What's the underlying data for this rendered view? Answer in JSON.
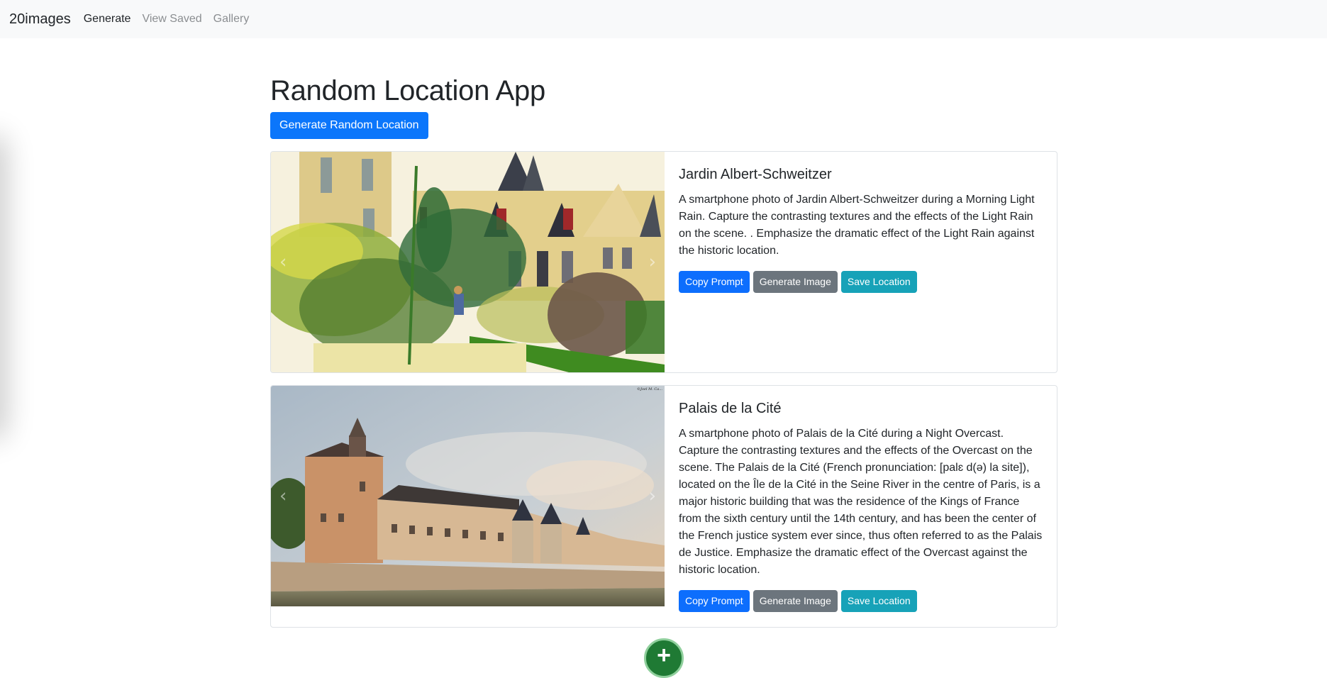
{
  "navbar": {
    "brand": "20images",
    "links": [
      {
        "label": "Generate",
        "active": true
      },
      {
        "label": "View Saved",
        "active": false
      },
      {
        "label": "Gallery",
        "active": false
      }
    ]
  },
  "main": {
    "title": "Random Location App",
    "generate_button": "Generate Random Location",
    "cards": [
      {
        "title": "Jardin Albert-Schweitzer",
        "image_description": "Watercolor sketch of a chateau with gardens and trees",
        "prompt": "A smartphone photo of Jardin Albert-Schweitzer during a Morning Light Rain. Capture the contrasting textures and the effects of the Light Rain on the scene. . Emphasize the dramatic effect of the Light Rain against the historic location.",
        "buttons": {
          "copy": "Copy Prompt",
          "generate": "Generate Image",
          "save": "Save Location"
        }
      },
      {
        "title": "Palais de la Cité",
        "image_description": "Photo of the Conciergerie along the Seine under a cloudy sky",
        "image_watermark": "©Joel M. Ca...",
        "prompt": "A smartphone photo of Palais de la Cité during a Night Overcast. Capture the contrasting textures and the effects of the Overcast on the scene. The Palais de la Cité (French pronunciation: [palɛ d(ə) la site]), located on the Île de la Cité in the Seine River in the centre of Paris, is a major historic building that was the residence of the Kings of France from the sixth century until the 14th century, and has been the center of the French justice system ever since, thus often referred to as the Palais de Justice. Emphasize the dramatic effect of the Overcast against the historic location.",
        "buttons": {
          "copy": "Copy Prompt",
          "generate": "Generate Image",
          "save": "Save Location"
        }
      }
    ],
    "carousel_controls": {
      "prev": "‹",
      "next": "›"
    },
    "fab_label": "+"
  },
  "colors": {
    "primary": "#0d6efd",
    "secondary": "#6c757d",
    "info": "#17a2b8",
    "fab": "#1f7a34",
    "navbar_bg": "#f8f9fa"
  }
}
